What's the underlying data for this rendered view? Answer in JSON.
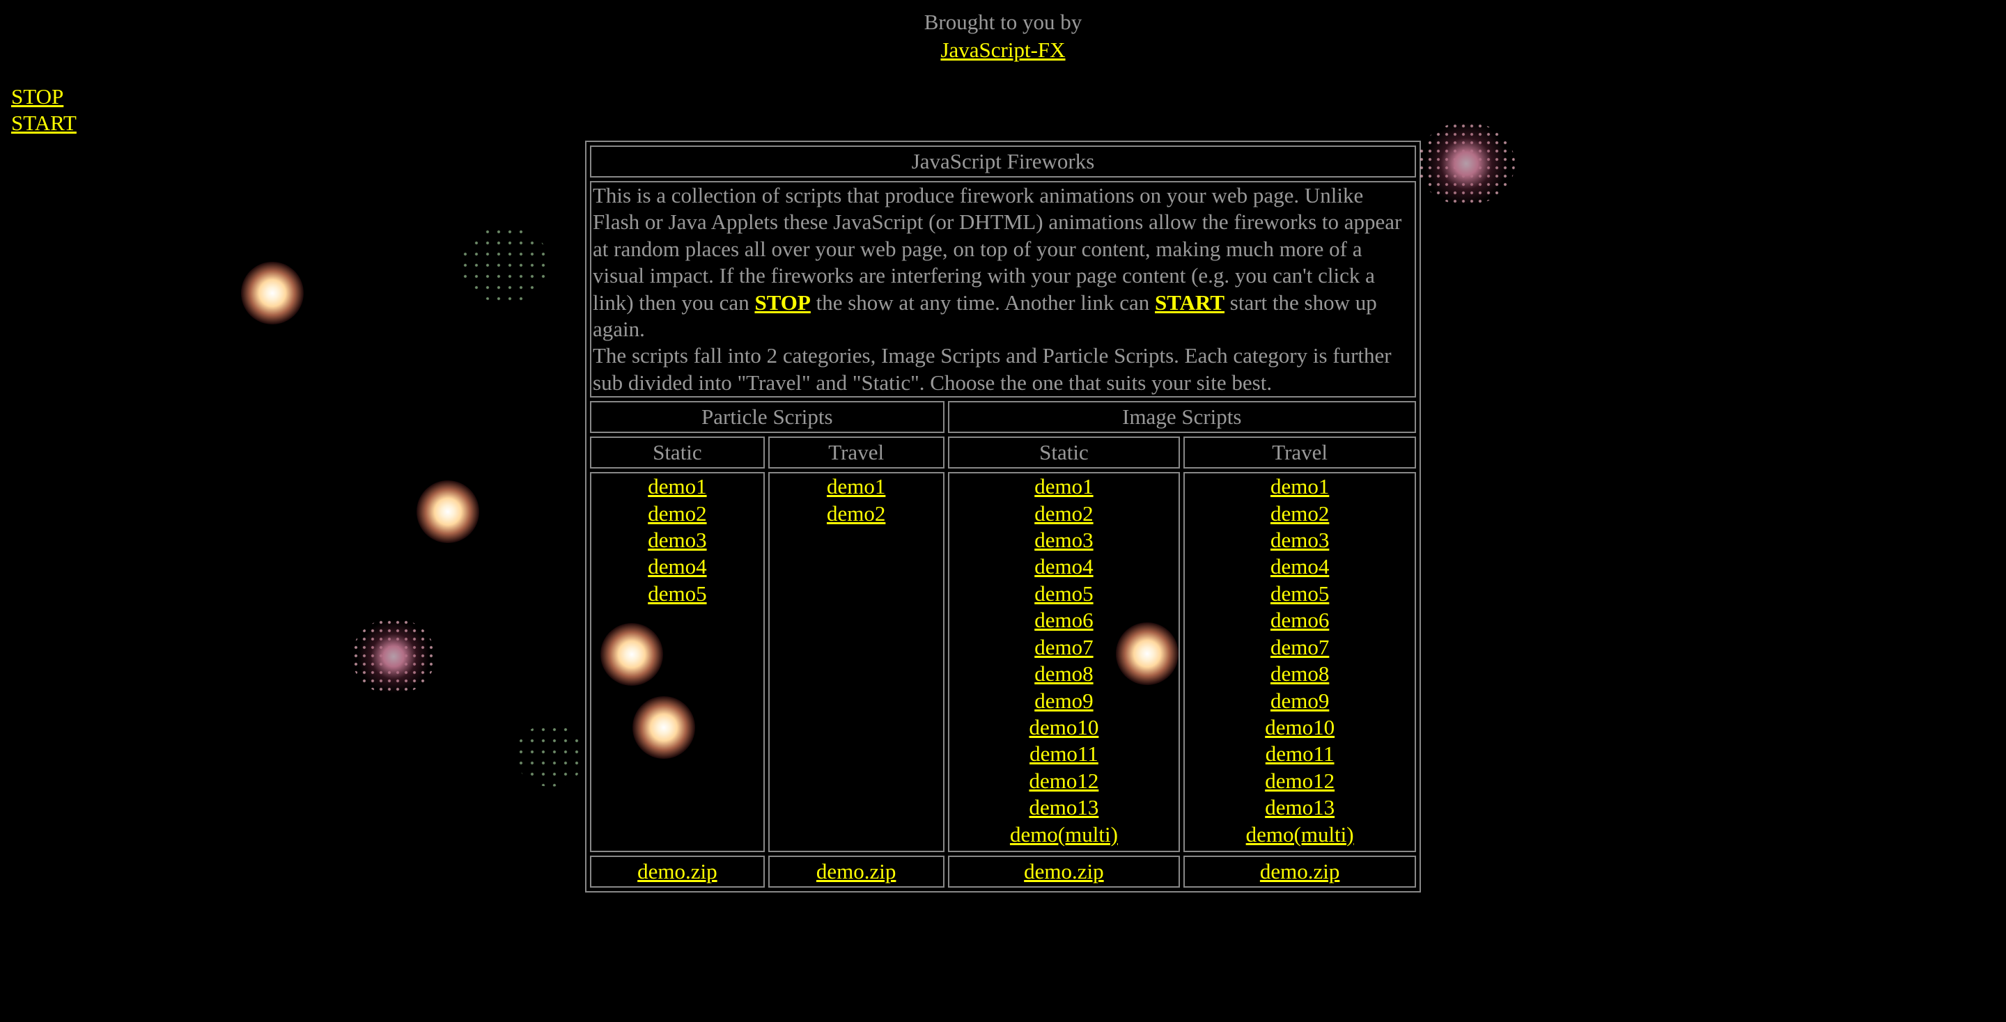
{
  "header": {
    "line1": "Brought to you by",
    "link": "JavaScript-FX"
  },
  "controls": {
    "stop": "STOP",
    "start": "START"
  },
  "table": {
    "title": "JavaScript Fireworks",
    "desc": {
      "p1_a": "This is a collection of scripts that produce firework animations on your web page. Unlike Flash or Java Applets these JavaScript (or DHTML) animations allow the fireworks to appear at random places all over your web page, on top of your content, making much more of a visual impact. If the fireworks are interfering with your page content (e.g. you can't click a link) then you can",
      "stop_link": "STOP",
      "p1_b": "the show at any time. Another link can",
      "start_link": "START",
      "p1_c": "start the show up again.",
      "p2": "The scripts fall into 2 categories, Image Scripts and Particle Scripts. Each category is further sub divided into \"Travel\" and \"Static\". Choose the one that suits your site best."
    },
    "groups": {
      "particle": "Particle Scripts",
      "image": "Image Scripts"
    },
    "sub": {
      "particle_static": "Static",
      "particle_travel": "Travel",
      "image_static": "Static",
      "image_travel": "Travel"
    },
    "columns": {
      "particle_static": [
        "demo1",
        "demo2",
        "demo3",
        "demo4",
        "demo5"
      ],
      "particle_travel": [
        "demo1",
        "demo2"
      ],
      "image_static": [
        "demo1",
        "demo2",
        "demo3",
        "demo4",
        "demo5",
        "demo6",
        "demo7",
        "demo8",
        "demo9",
        "demo10",
        "demo11",
        "demo12",
        "demo13",
        "demo(multi)"
      ],
      "image_travel": [
        "demo1",
        "demo2",
        "demo3",
        "demo4",
        "demo5",
        "demo6",
        "demo7",
        "demo8",
        "demo9",
        "demo10",
        "demo11",
        "demo12",
        "demo13",
        "demo(multi)"
      ]
    },
    "zip": {
      "particle_static": "demo.zip",
      "particle_travel": "demo.zip",
      "image_static": "demo.zip",
      "image_travel": "demo.zip"
    }
  },
  "colors": {
    "background": "#000000",
    "text": "#999999",
    "link": "#ffff00",
    "border": "#888888"
  }
}
